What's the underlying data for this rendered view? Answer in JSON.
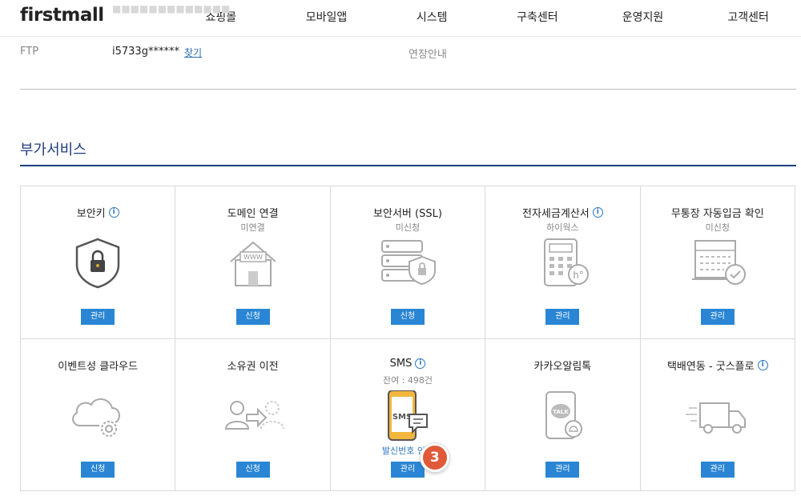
{
  "brand": {
    "logo": "firstmall"
  },
  "nav": {
    "items": [
      {
        "label": "쇼핑몰"
      },
      {
        "label": "모바일앱"
      },
      {
        "label": "시스템"
      },
      {
        "label": "구축센터"
      },
      {
        "label": "운영지원"
      },
      {
        "label": "고객센터"
      }
    ]
  },
  "info": {
    "ftp_label": "FTP",
    "ftp_value": "i5733g******",
    "ftp_find": "찾기",
    "extension_label": "연장안내"
  },
  "section": {
    "title": "부가서비스"
  },
  "services": [
    {
      "title": "보안키",
      "has_info": true,
      "sub": "",
      "link": "",
      "button": "관리",
      "icon": "shield-lock-icon"
    },
    {
      "title": "도메인 연결",
      "has_info": false,
      "sub": "미연결",
      "link": "",
      "button": "신청",
      "icon": "www-house-icon"
    },
    {
      "title": "보안서버 (SSL)",
      "has_info": false,
      "sub": "미신청",
      "link": "",
      "button": "신청",
      "icon": "server-shield-icon"
    },
    {
      "title": "전자세금계산서",
      "has_info": true,
      "sub": "하이웍스",
      "link": "",
      "button": "관리",
      "icon": "calculator-icon"
    },
    {
      "title": "무통장 자동입금 확인",
      "has_info": false,
      "sub": "미신청",
      "link": "",
      "button": "관리",
      "icon": "bankbook-check-icon"
    },
    {
      "title": "이벤트성 클라우드",
      "has_info": false,
      "sub": "",
      "link": "",
      "button": "신청",
      "icon": "cloud-gear-icon"
    },
    {
      "title": "소유권 이전",
      "has_info": false,
      "sub": "",
      "link": "",
      "button": "신청",
      "icon": "user-transfer-icon"
    },
    {
      "title": "SMS",
      "has_info": true,
      "sub": "잔여 : 498건",
      "link": "발신번호 인증",
      "button": "관리",
      "icon": "sms-phone-icon",
      "badge": "3"
    },
    {
      "title": "카카오알림톡",
      "has_info": false,
      "sub": "",
      "link": "",
      "button": "관리",
      "icon": "kakao-talk-icon"
    },
    {
      "title": "택배연동 - 굿스플로",
      "has_info": true,
      "sub": "",
      "link": "",
      "button": "관리",
      "icon": "delivery-truck-icon"
    }
  ],
  "colors": {
    "accent": "#2a86d4",
    "section": "#1f3d7a",
    "badge": "#e05a3a",
    "sms_phone": "#f2b63c"
  }
}
